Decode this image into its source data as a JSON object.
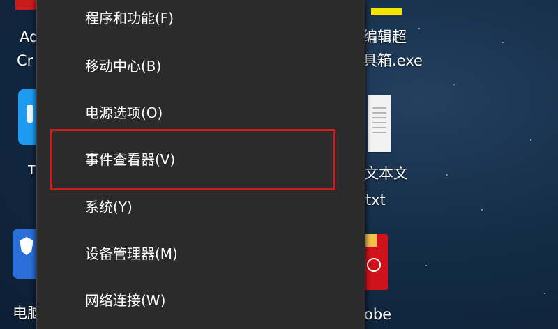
{
  "context_menu": {
    "items": [
      {
        "label": "程序和功能(F)"
      },
      {
        "label": "移动中心(B)"
      },
      {
        "label": "电源选项(O)"
      },
      {
        "label": "事件查看器(V)",
        "highlighted": true
      },
      {
        "label": "系统(Y)"
      },
      {
        "label": "设备管理器(M)"
      },
      {
        "label": "网络连接(W)"
      }
    ]
  },
  "desktop": {
    "left_icons": [
      {
        "label_line1": "Ad",
        "label_line2": "Cr",
        "icon": "acrobat-red-icon"
      },
      {
        "label_line1": "T",
        "icon": "teamviewer-icon"
      },
      {
        "label_line1": "电脑",
        "icon": "shield-security-icon"
      }
    ],
    "right_icons": [
      {
        "label_line1": "编辑超",
        "label_line2": "具箱.exe",
        "icon": "exe-app-icon"
      },
      {
        "label_line1": "文本文",
        "label_line2": "txt",
        "icon": "text-document-icon"
      },
      {
        "label_line1": "obe",
        "icon": "adobe-pdf-icon"
      }
    ]
  },
  "colors": {
    "menu_bg": "#2b2b2b",
    "menu_text": "#ffffff",
    "highlight_border": "#c81e1e",
    "desktop_bg": "#142c46"
  }
}
